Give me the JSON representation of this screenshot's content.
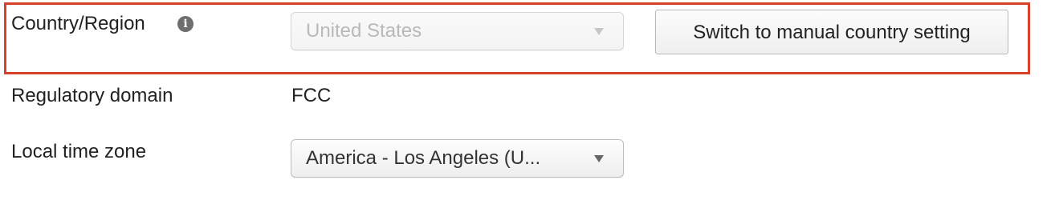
{
  "country_region": {
    "label": "Country/Region",
    "info_icon_glyph": "i",
    "select_value": "United States",
    "select_disabled": true,
    "switch_button_label": "Switch to manual country setting"
  },
  "regulatory_domain": {
    "label": "Regulatory domain",
    "value": "FCC"
  },
  "local_time_zone": {
    "label": "Local time zone",
    "select_value": "America - Los Angeles (U..."
  },
  "colors": {
    "highlight_border": "#d9412b",
    "text": "#222222",
    "disabled_text": "#b9b9b9"
  },
  "icons": {
    "info": "info-icon",
    "dropdown": "chevron-down-icon"
  }
}
